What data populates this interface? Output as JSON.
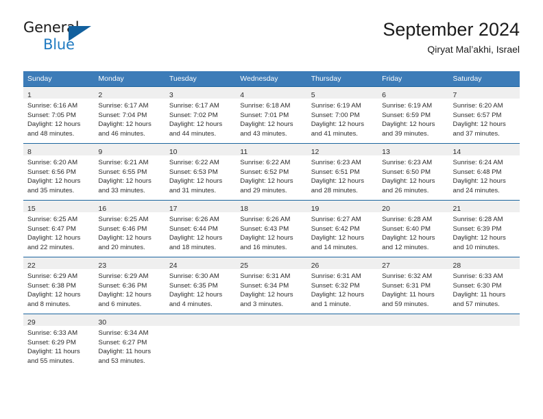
{
  "brand": {
    "name_part1": "General",
    "name_part2": "Blue",
    "logo_icon": "triangle-logo-icon",
    "accent_color": "#1f7ac1",
    "dark_color": "#12609e"
  },
  "header": {
    "title": "September 2024",
    "subtitle": "Qiryat Mal’akhi, Israel"
  },
  "theme": {
    "header_row_bg": "#3d7cb8",
    "week_divider": "#19639e",
    "daynum_band_bg": "#efefef",
    "text_color": "#2b2b2b"
  },
  "weekday_headers": [
    "Sunday",
    "Monday",
    "Tuesday",
    "Wednesday",
    "Thursday",
    "Friday",
    "Saturday"
  ],
  "weeks": [
    [
      {
        "day": "1",
        "sunrise": "Sunrise: 6:16 AM",
        "sunset": "Sunset: 7:05 PM",
        "daylight_line1": "Daylight: 12 hours",
        "daylight_line2": "and 48 minutes."
      },
      {
        "day": "2",
        "sunrise": "Sunrise: 6:17 AM",
        "sunset": "Sunset: 7:04 PM",
        "daylight_line1": "Daylight: 12 hours",
        "daylight_line2": "and 46 minutes."
      },
      {
        "day": "3",
        "sunrise": "Sunrise: 6:17 AM",
        "sunset": "Sunset: 7:02 PM",
        "daylight_line1": "Daylight: 12 hours",
        "daylight_line2": "and 44 minutes."
      },
      {
        "day": "4",
        "sunrise": "Sunrise: 6:18 AM",
        "sunset": "Sunset: 7:01 PM",
        "daylight_line1": "Daylight: 12 hours",
        "daylight_line2": "and 43 minutes."
      },
      {
        "day": "5",
        "sunrise": "Sunrise: 6:19 AM",
        "sunset": "Sunset: 7:00 PM",
        "daylight_line1": "Daylight: 12 hours",
        "daylight_line2": "and 41 minutes."
      },
      {
        "day": "6",
        "sunrise": "Sunrise: 6:19 AM",
        "sunset": "Sunset: 6:59 PM",
        "daylight_line1": "Daylight: 12 hours",
        "daylight_line2": "and 39 minutes."
      },
      {
        "day": "7",
        "sunrise": "Sunrise: 6:20 AM",
        "sunset": "Sunset: 6:57 PM",
        "daylight_line1": "Daylight: 12 hours",
        "daylight_line2": "and 37 minutes."
      }
    ],
    [
      {
        "day": "8",
        "sunrise": "Sunrise: 6:20 AM",
        "sunset": "Sunset: 6:56 PM",
        "daylight_line1": "Daylight: 12 hours",
        "daylight_line2": "and 35 minutes."
      },
      {
        "day": "9",
        "sunrise": "Sunrise: 6:21 AM",
        "sunset": "Sunset: 6:55 PM",
        "daylight_line1": "Daylight: 12 hours",
        "daylight_line2": "and 33 minutes."
      },
      {
        "day": "10",
        "sunrise": "Sunrise: 6:22 AM",
        "sunset": "Sunset: 6:53 PM",
        "daylight_line1": "Daylight: 12 hours",
        "daylight_line2": "and 31 minutes."
      },
      {
        "day": "11",
        "sunrise": "Sunrise: 6:22 AM",
        "sunset": "Sunset: 6:52 PM",
        "daylight_line1": "Daylight: 12 hours",
        "daylight_line2": "and 29 minutes."
      },
      {
        "day": "12",
        "sunrise": "Sunrise: 6:23 AM",
        "sunset": "Sunset: 6:51 PM",
        "daylight_line1": "Daylight: 12 hours",
        "daylight_line2": "and 28 minutes."
      },
      {
        "day": "13",
        "sunrise": "Sunrise: 6:23 AM",
        "sunset": "Sunset: 6:50 PM",
        "daylight_line1": "Daylight: 12 hours",
        "daylight_line2": "and 26 minutes."
      },
      {
        "day": "14",
        "sunrise": "Sunrise: 6:24 AM",
        "sunset": "Sunset: 6:48 PM",
        "daylight_line1": "Daylight: 12 hours",
        "daylight_line2": "and 24 minutes."
      }
    ],
    [
      {
        "day": "15",
        "sunrise": "Sunrise: 6:25 AM",
        "sunset": "Sunset: 6:47 PM",
        "daylight_line1": "Daylight: 12 hours",
        "daylight_line2": "and 22 minutes."
      },
      {
        "day": "16",
        "sunrise": "Sunrise: 6:25 AM",
        "sunset": "Sunset: 6:46 PM",
        "daylight_line1": "Daylight: 12 hours",
        "daylight_line2": "and 20 minutes."
      },
      {
        "day": "17",
        "sunrise": "Sunrise: 6:26 AM",
        "sunset": "Sunset: 6:44 PM",
        "daylight_line1": "Daylight: 12 hours",
        "daylight_line2": "and 18 minutes."
      },
      {
        "day": "18",
        "sunrise": "Sunrise: 6:26 AM",
        "sunset": "Sunset: 6:43 PM",
        "daylight_line1": "Daylight: 12 hours",
        "daylight_line2": "and 16 minutes."
      },
      {
        "day": "19",
        "sunrise": "Sunrise: 6:27 AM",
        "sunset": "Sunset: 6:42 PM",
        "daylight_line1": "Daylight: 12 hours",
        "daylight_line2": "and 14 minutes."
      },
      {
        "day": "20",
        "sunrise": "Sunrise: 6:28 AM",
        "sunset": "Sunset: 6:40 PM",
        "daylight_line1": "Daylight: 12 hours",
        "daylight_line2": "and 12 minutes."
      },
      {
        "day": "21",
        "sunrise": "Sunrise: 6:28 AM",
        "sunset": "Sunset: 6:39 PM",
        "daylight_line1": "Daylight: 12 hours",
        "daylight_line2": "and 10 minutes."
      }
    ],
    [
      {
        "day": "22",
        "sunrise": "Sunrise: 6:29 AM",
        "sunset": "Sunset: 6:38 PM",
        "daylight_line1": "Daylight: 12 hours",
        "daylight_line2": "and 8 minutes."
      },
      {
        "day": "23",
        "sunrise": "Sunrise: 6:29 AM",
        "sunset": "Sunset: 6:36 PM",
        "daylight_line1": "Daylight: 12 hours",
        "daylight_line2": "and 6 minutes."
      },
      {
        "day": "24",
        "sunrise": "Sunrise: 6:30 AM",
        "sunset": "Sunset: 6:35 PM",
        "daylight_line1": "Daylight: 12 hours",
        "daylight_line2": "and 4 minutes."
      },
      {
        "day": "25",
        "sunrise": "Sunrise: 6:31 AM",
        "sunset": "Sunset: 6:34 PM",
        "daylight_line1": "Daylight: 12 hours",
        "daylight_line2": "and 3 minutes."
      },
      {
        "day": "26",
        "sunrise": "Sunrise: 6:31 AM",
        "sunset": "Sunset: 6:32 PM",
        "daylight_line1": "Daylight: 12 hours",
        "daylight_line2": "and 1 minute."
      },
      {
        "day": "27",
        "sunrise": "Sunrise: 6:32 AM",
        "sunset": "Sunset: 6:31 PM",
        "daylight_line1": "Daylight: 11 hours",
        "daylight_line2": "and 59 minutes."
      },
      {
        "day": "28",
        "sunrise": "Sunrise: 6:33 AM",
        "sunset": "Sunset: 6:30 PM",
        "daylight_line1": "Daylight: 11 hours",
        "daylight_line2": "and 57 minutes."
      }
    ],
    [
      {
        "day": "29",
        "sunrise": "Sunrise: 6:33 AM",
        "sunset": "Sunset: 6:29 PM",
        "daylight_line1": "Daylight: 11 hours",
        "daylight_line2": "and 55 minutes."
      },
      {
        "day": "30",
        "sunrise": "Sunrise: 6:34 AM",
        "sunset": "Sunset: 6:27 PM",
        "daylight_line1": "Daylight: 11 hours",
        "daylight_line2": "and 53 minutes."
      },
      {
        "day": "",
        "sunrise": "",
        "sunset": "",
        "daylight_line1": "",
        "daylight_line2": ""
      },
      {
        "day": "",
        "sunrise": "",
        "sunset": "",
        "daylight_line1": "",
        "daylight_line2": ""
      },
      {
        "day": "",
        "sunrise": "",
        "sunset": "",
        "daylight_line1": "",
        "daylight_line2": ""
      },
      {
        "day": "",
        "sunrise": "",
        "sunset": "",
        "daylight_line1": "",
        "daylight_line2": ""
      },
      {
        "day": "",
        "sunrise": "",
        "sunset": "",
        "daylight_line1": "",
        "daylight_line2": ""
      }
    ]
  ]
}
